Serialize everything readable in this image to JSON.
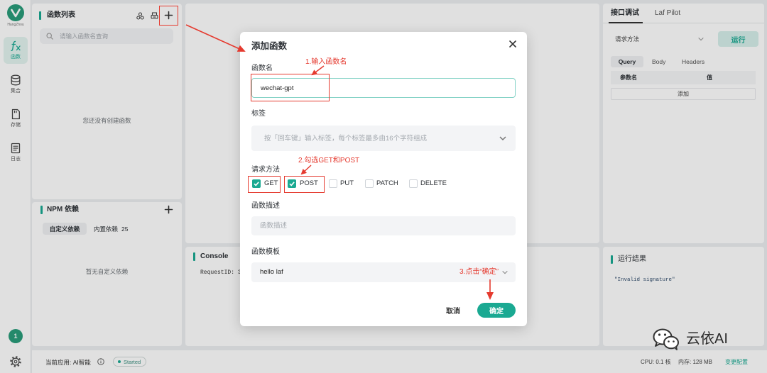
{
  "sidebar": {
    "brand_caption": "HangZhou",
    "items": [
      {
        "label": "函数",
        "icon": "function-icon",
        "active": true
      },
      {
        "label": "集合",
        "icon": "database-icon"
      },
      {
        "label": "存储",
        "icon": "storage-icon"
      },
      {
        "label": "日志",
        "icon": "log-icon"
      }
    ],
    "notification_count": "1",
    "settings_icon": "gear-icon"
  },
  "function_list": {
    "title": "函数列表",
    "search_placeholder": "请输入函数名查询",
    "empty_text": "您还没有创建函数"
  },
  "npm": {
    "title": "NPM 依赖",
    "tabs": [
      {
        "label": "自定义依赖",
        "active": true
      },
      {
        "label": "内置依赖",
        "count": "25"
      }
    ],
    "empty_text": "暂无自定义依赖"
  },
  "console": {
    "title": "Console",
    "request_id": "RequestID: 3"
  },
  "debug": {
    "tabs": [
      {
        "label": "接口调试",
        "active": true
      },
      {
        "label": "Laf Pilot"
      }
    ],
    "method_placeholder": "请求方法",
    "run_label": "运行",
    "param_tabs": [
      {
        "label": "Query",
        "active": true
      },
      {
        "label": "Body"
      },
      {
        "label": "Headers"
      }
    ],
    "columns": [
      "参数名",
      "值"
    ],
    "add_label": "添加"
  },
  "result": {
    "title": "运行结果",
    "output": "\"Invalid signature\""
  },
  "status_bar": {
    "app": "当前应用: AI智能",
    "status": "Started",
    "cpu": "CPU: 0.1 核",
    "memory": "内存: 128 MB",
    "change_config": "变更配置"
  },
  "modal": {
    "title": "添加函数",
    "name_label": "函数名",
    "name_value": "wechat-gpt",
    "tags_label": "标签",
    "tags_placeholder": "按「回车键」输入标签，每个标签最多由16个字符组成",
    "methods_label": "请求方法",
    "methods": [
      {
        "label": "GET",
        "checked": true
      },
      {
        "label": "POST",
        "checked": true
      },
      {
        "label": "PUT",
        "checked": false
      },
      {
        "label": "PATCH",
        "checked": false
      },
      {
        "label": "DELETE",
        "checked": false
      }
    ],
    "description_label": "函数描述",
    "description_placeholder": "函数描述",
    "template_label": "函数模板",
    "template_value": "hello laf",
    "cancel_label": "取消",
    "confirm_label": "确定"
  },
  "annotations": {
    "step1": "1.输入函数名",
    "step2": "2.勾选GET和POST",
    "step3": "3.点击“确定”"
  },
  "watermark": {
    "text": "云依AI",
    "icon": "wechat-icon"
  },
  "colors": {
    "accent": "#1aa992",
    "annotation": "#e53a2f",
    "brand": "#2a9d7a"
  }
}
